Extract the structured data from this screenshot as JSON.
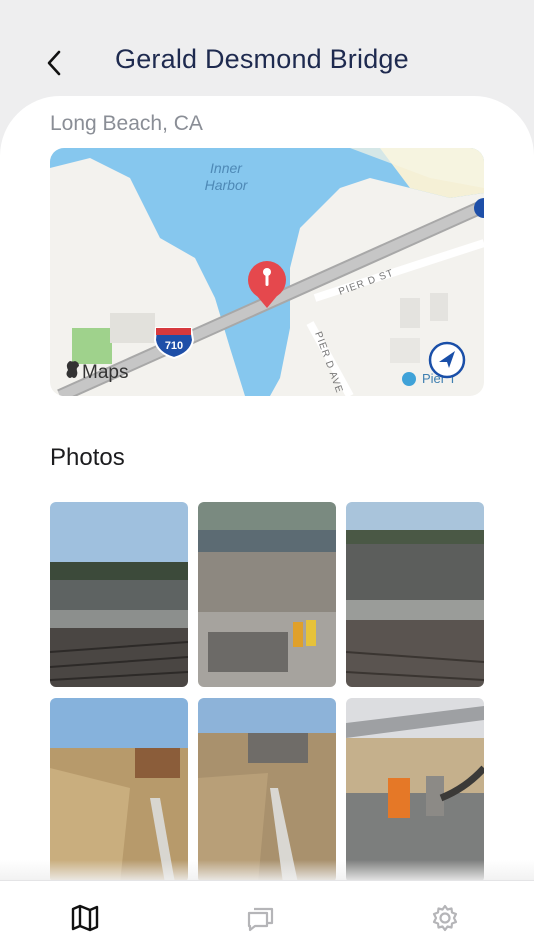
{
  "header": {
    "title": "Gerald Desmond Bridge",
    "back_icon": "chevron-left-icon"
  },
  "location": {
    "subtitle": "Long Beach, CA"
  },
  "map": {
    "water_label_line1": "Inner",
    "water_label_line2": "Harbor",
    "street1": "PIER D ST",
    "street2": "PIER D AVE",
    "shield": "710",
    "attribution": "Maps",
    "poi": "Pier T",
    "pin_color": "#e5484d",
    "water_color": "#86c7ee",
    "land_color": "#f3f2ee"
  },
  "photos": {
    "section_title": "Photos",
    "items": [
      {
        "alt": "rail yard with retaining wall"
      },
      {
        "alt": "construction site with workers"
      },
      {
        "alt": "concrete wall along tracks"
      },
      {
        "alt": "excavation with steel beams"
      },
      {
        "alt": "trench and formwork"
      },
      {
        "alt": "workers pouring concrete"
      }
    ]
  },
  "tabbar": {
    "tabs": [
      {
        "name": "map",
        "icon": "map-icon",
        "active": true
      },
      {
        "name": "messages",
        "icon": "chat-icon",
        "active": false
      },
      {
        "name": "settings",
        "icon": "gear-icon",
        "active": false
      }
    ]
  }
}
